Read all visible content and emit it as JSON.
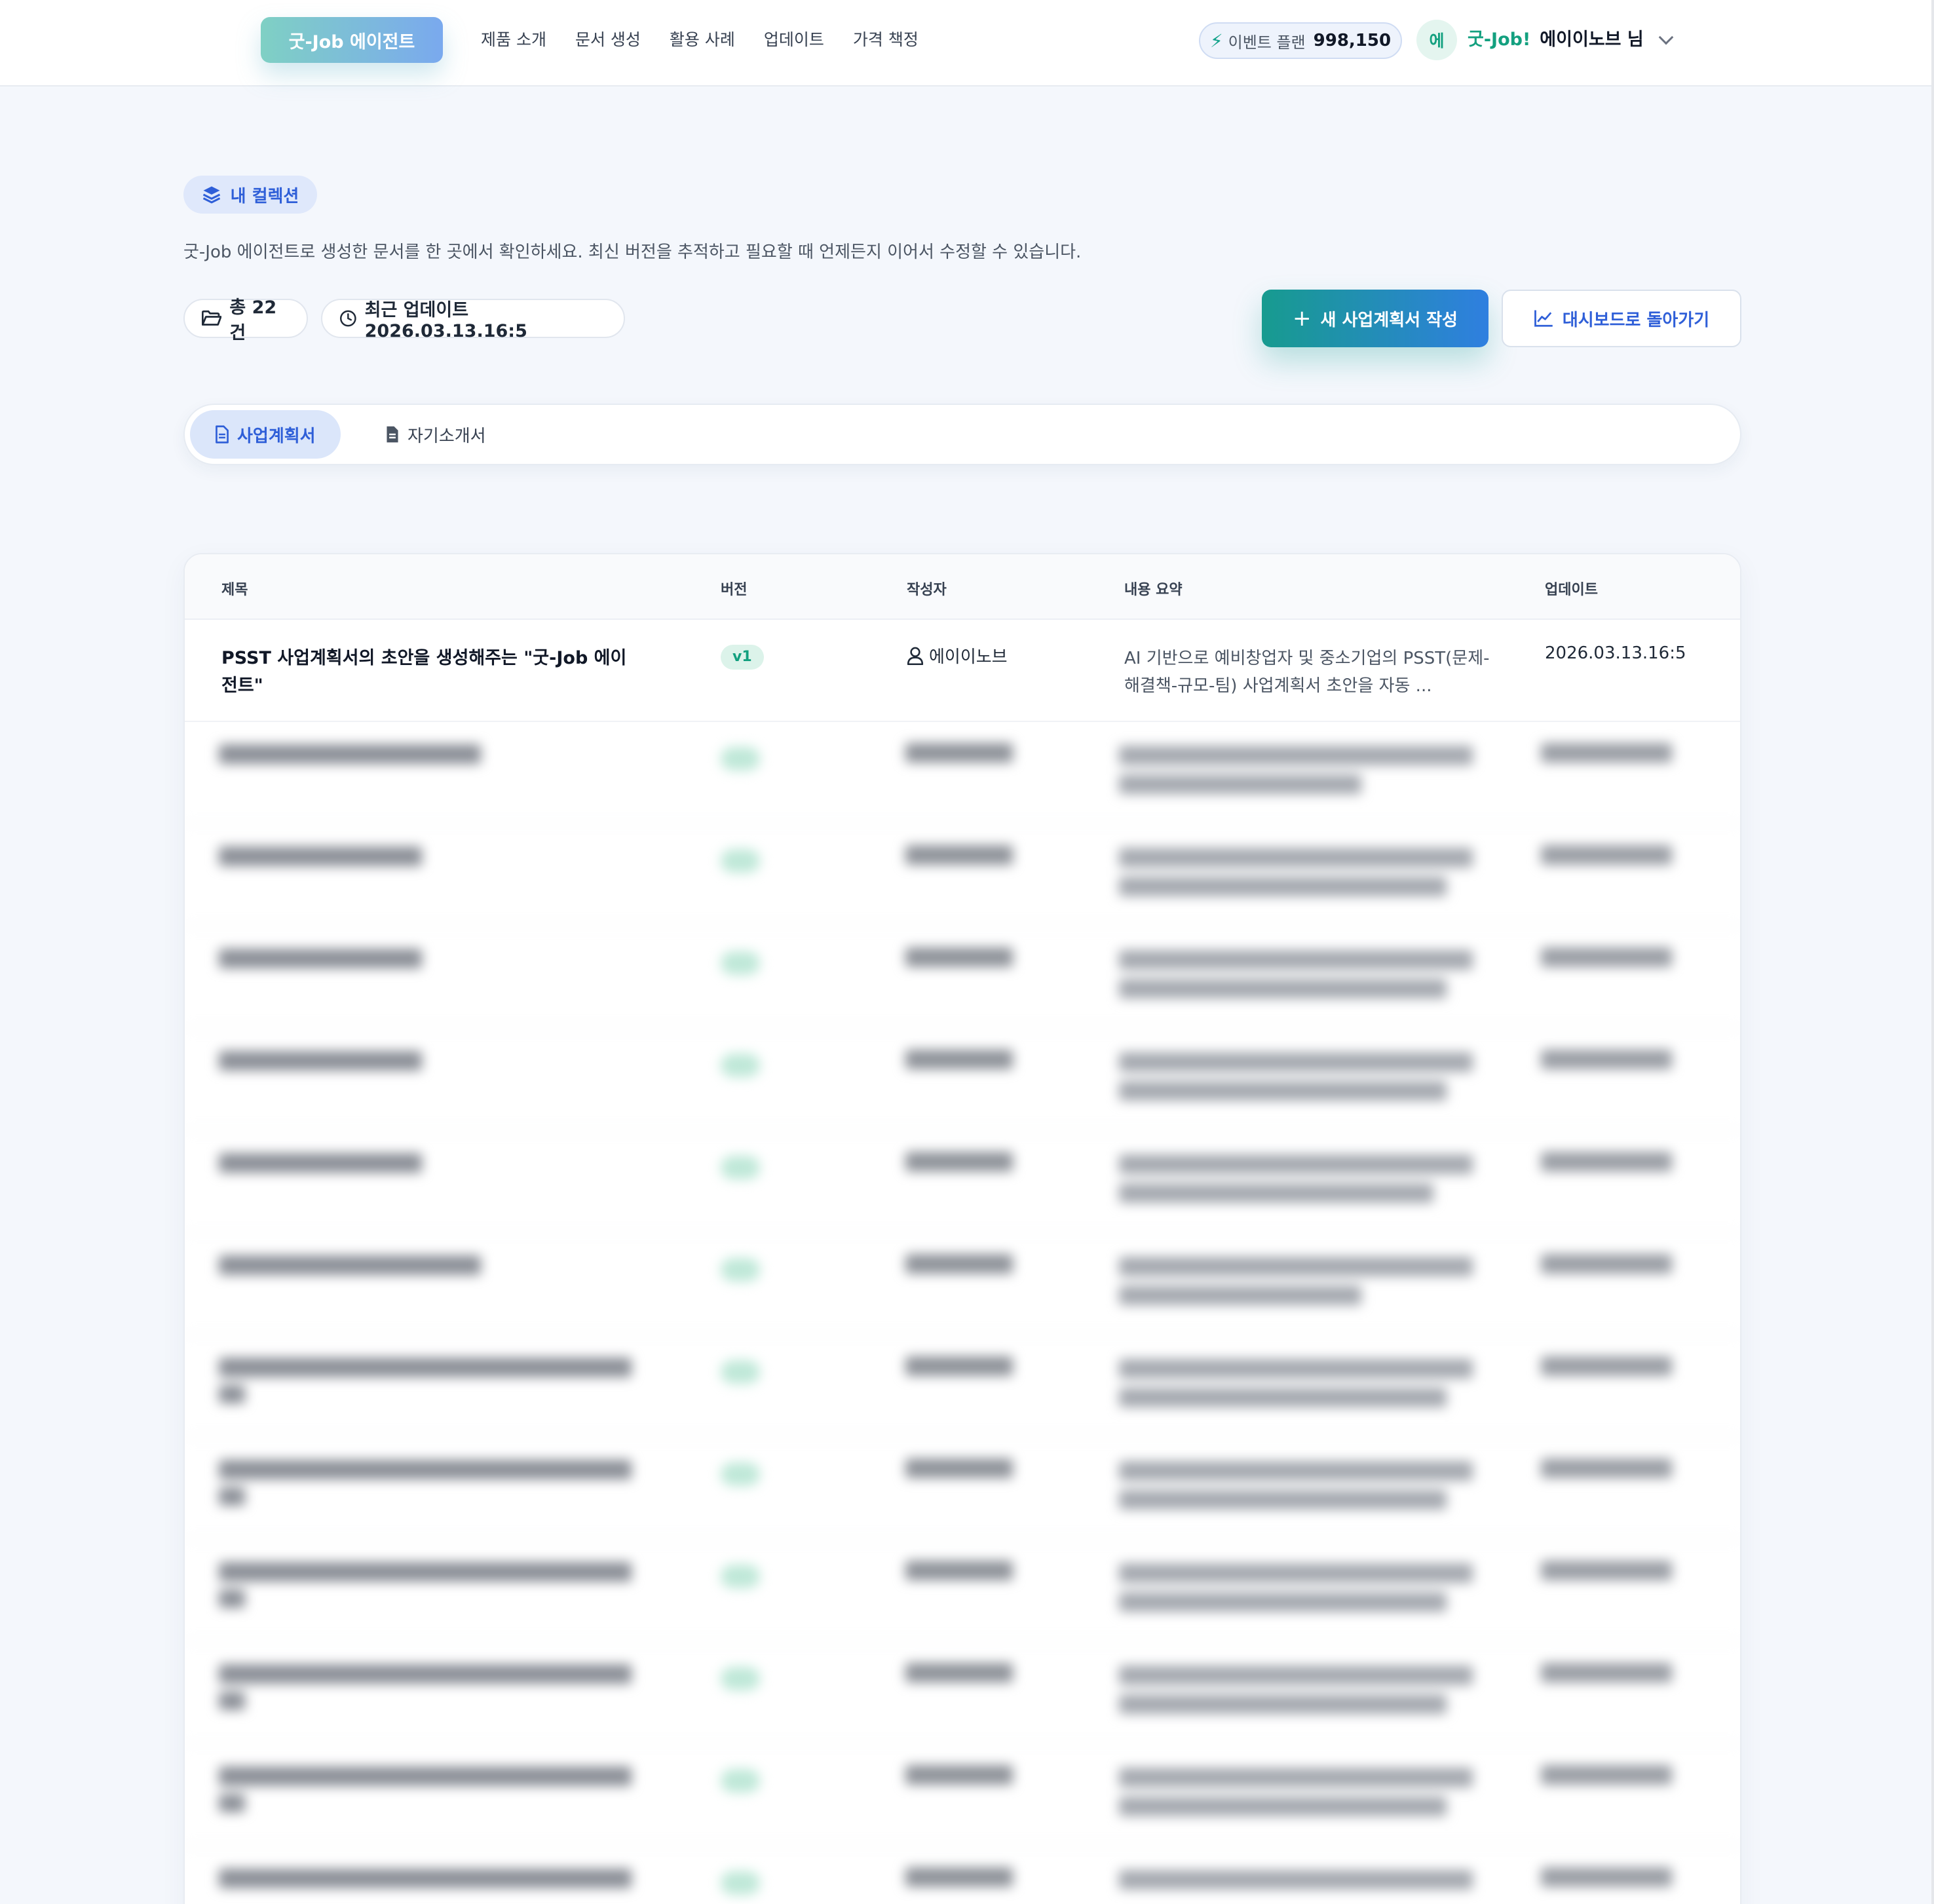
{
  "nav": {
    "brand": "굿-Job 에이전트",
    "links": [
      "제품 소개",
      "문서 생성",
      "활용 사례",
      "업데이트",
      "가격 책정"
    ],
    "plan_label": "이벤트 플랜",
    "plan_value": "998,150",
    "avatar_initial": "에",
    "user_brand": "굿-Job!",
    "user_name": "에이이노브 님"
  },
  "header": {
    "badge": "내 컬렉션",
    "description": "굿-Job 에이전트로 생성한 문서를 한 곳에서 확인하세요. 최신 버전을 추적하고 필요할 때 언제든지 이어서 수정할 수 있습니다.",
    "total": "총 22건",
    "last_update": "최근 업데이트 2026.03.13.16:5",
    "new_button": "새 사업계획서 작성",
    "dashboard_button": "대시보드로 돌아가기"
  },
  "tabs": [
    {
      "label": "사업계획서",
      "active": true
    },
    {
      "label": "자기소개서",
      "active": false
    }
  ],
  "table": {
    "columns": [
      "제목",
      "버전",
      "작성자",
      "내용 요약",
      "업데이트"
    ],
    "rows": [
      {
        "title": "PSST 사업계획서의 초안을 생성해주는 \"굿-Job 에이전트\"",
        "version": "v1",
        "author": "에이이노브",
        "summary": "AI 기반으로 예비창업자 및 중소기업의 PSST(문제-해결책-규모-팀) 사업계획서 초안을 자동 ...",
        "updated": "2026.03.13.16:5"
      }
    ]
  },
  "colors": {
    "accent_teal": "#13a07f",
    "accent_blue": "#2f5fd8",
    "background": "#f4f7fc"
  }
}
